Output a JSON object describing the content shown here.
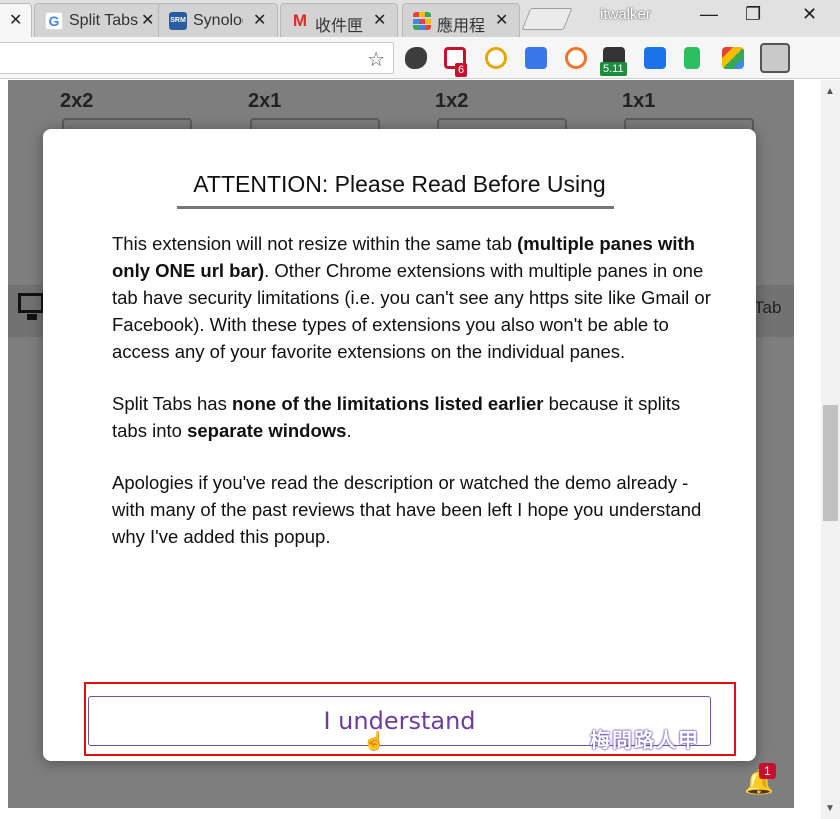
{
  "browser": {
    "tabs": [
      {
        "title": "",
        "favicon": "unknown-favicon",
        "color": "#f6f6f6"
      },
      {
        "title": "Split Tabs",
        "favicon": "google-g-icon",
        "color": "#4285f4"
      },
      {
        "title": "Synology",
        "favicon": "synology-srm-icon",
        "color": "#2a5d9f"
      },
      {
        "title": "收件匣",
        "favicon": "gmail-icon",
        "color": "#d93025"
      },
      {
        "title": "應用程式",
        "favicon": "apps-grid-icon",
        "color": "#e94235"
      }
    ],
    "close_glyph": "✕",
    "profile_name": "itwalker",
    "window_controls": {
      "minimize": "—",
      "maximize": "❐",
      "close": "✕"
    },
    "star_glyph": "☆",
    "extensions": [
      {
        "name": "evernote-icon",
        "color": "#3d3d3d"
      },
      {
        "name": "gmail-checker-icon",
        "color": "#c8102e",
        "badge": "6"
      },
      {
        "name": "search-lens-icon",
        "color": "#e6a800"
      },
      {
        "name": "google-translate-icon",
        "color": "#3b78e7"
      },
      {
        "name": "weibo-icon",
        "color": "#f0742a"
      },
      {
        "name": "stock-ticker-icon",
        "color": "#333333",
        "badge": "5.11"
      },
      {
        "name": "gear-extension-icon",
        "color": "#1a73e8"
      },
      {
        "name": "evernote-clip-icon",
        "color": "#2dbe60"
      },
      {
        "name": "puzzle-colors-icon",
        "color": "#e94235"
      },
      {
        "name": "split-tabs-icon",
        "color": "#555555"
      }
    ]
  },
  "page": {
    "layouts": [
      "2x2",
      "2x1",
      "1x2",
      "1x1"
    ],
    "strip_text": "Tab",
    "notification_count": "1"
  },
  "modal": {
    "title": "ATTENTION: Please Read Before Using",
    "para1_a": "This extension will not resize within the same tab ",
    "para1_b": "(multiple panes with only ONE url bar)",
    "para1_c": ". Other Chrome extensions with multiple panes in one tab have security limitations (i.e. you can't see any https site like Gmail or Facebook). With these types of extensions you also won't be able to access any of your favorite extensions on the individual panes.",
    "para2_a": "Split Tabs has ",
    "para2_b": "none of the limitations listed earlier",
    "para2_c": " because it splits tabs into ",
    "para2_d": "separate windows",
    "para2_e": ".",
    "para3": "Apologies if you've read the description or watched the demo already - with many of the past reviews that have been left I hope you understand why I've added this popup.",
    "button_label": "I understand"
  },
  "watermark": "梅問路人甲",
  "accent_colors": {
    "highlight": "#e10e14",
    "button": "#6a3da1"
  }
}
